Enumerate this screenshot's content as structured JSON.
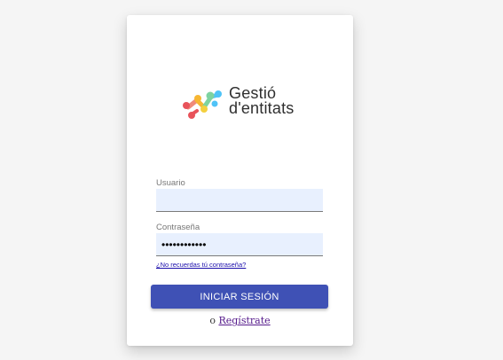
{
  "brand": {
    "line1": "Gestió",
    "line2": "d'entitats",
    "colors": [
      "#e8535a",
      "#f7b733",
      "#7ed3a0",
      "#4fc3f7"
    ]
  },
  "form": {
    "username_label": "Usuario",
    "username_value": "",
    "password_label": "Contraseña",
    "password_value": "••••••••••••",
    "forgot_link": "¿No recuerdas tú contraseña?",
    "submit_label": "INICIAR SESIÓN",
    "register_prefix": "o",
    "register_link": "Regístrate"
  },
  "colors": {
    "primary": "#3f51b5",
    "input_bg": "#e8f0fe"
  }
}
